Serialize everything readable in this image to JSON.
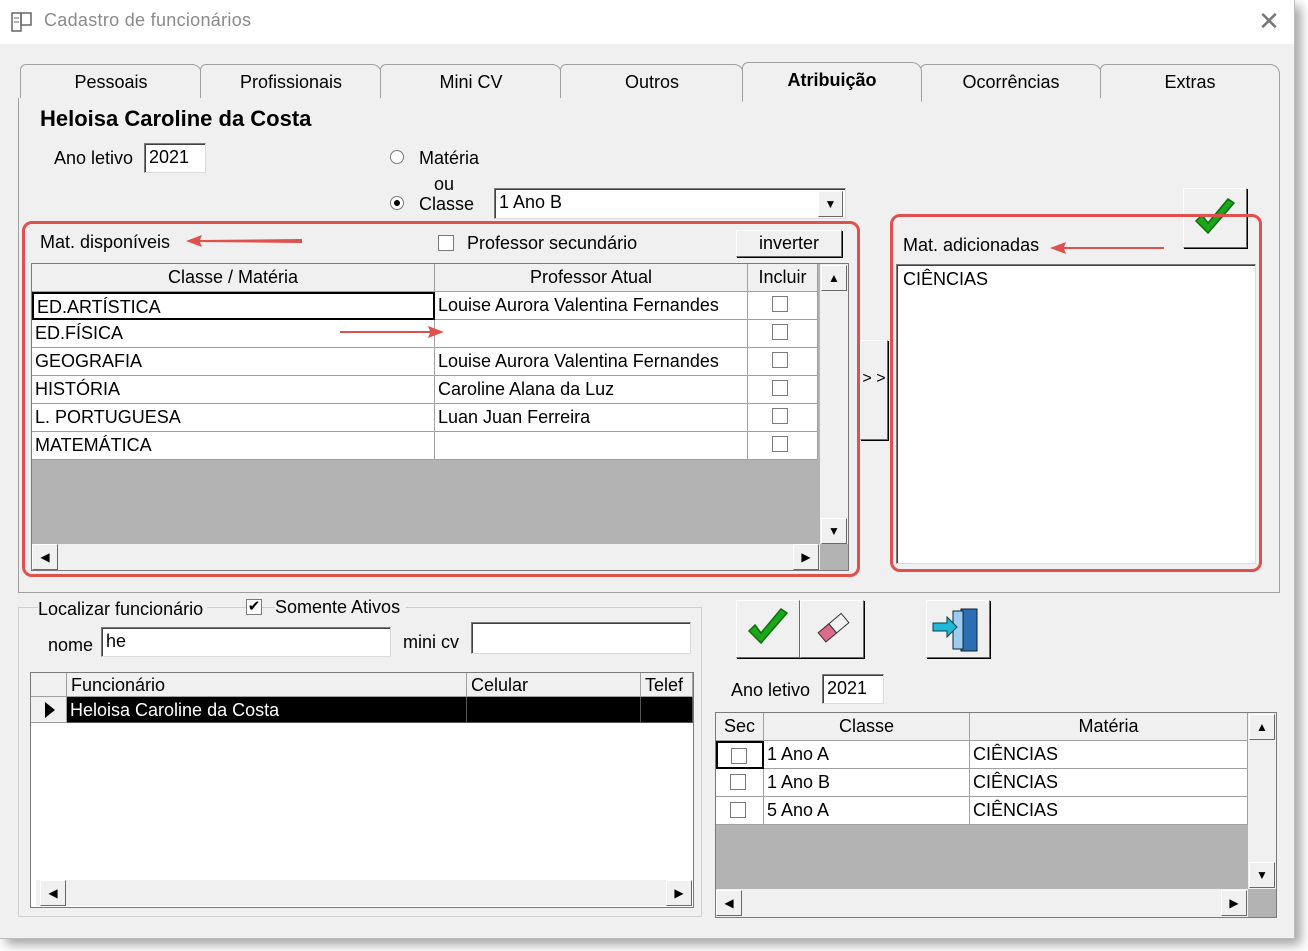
{
  "window": {
    "title": "Cadastro de funcionários",
    "close_label": "✕"
  },
  "tabs": [
    {
      "label": "Pessoais"
    },
    {
      "label": "Profissionais"
    },
    {
      "label": "Mini CV"
    },
    {
      "label": "Outros"
    },
    {
      "label": "Atribuição"
    },
    {
      "label": "Ocorrências"
    },
    {
      "label": "Extras"
    }
  ],
  "active_tab": "Atribuição",
  "employee_name": "Heloisa Caroline da Costa",
  "ano_letivo": {
    "label": "Ano letivo",
    "value": "2021"
  },
  "mode": {
    "materia_label": "Matéria",
    "ou_label": "ou",
    "classe_label": "Classe",
    "selected": "Classe",
    "classe_value": "1 Ano B"
  },
  "available": {
    "label": "Mat. disponíveis",
    "professor_secundario_label": "Professor secundário",
    "inverter_label": "inverter",
    "columns": [
      "Classe / Matéria",
      "Professor Atual",
      "Incluir"
    ],
    "rows": [
      {
        "materia": "ED.ARTÍSTICA",
        "professor": "Louise Aurora Valentina Fernandes"
      },
      {
        "materia": "ED.FÍSICA",
        "professor": ""
      },
      {
        "materia": "GEOGRAFIA",
        "professor": "Louise Aurora Valentina Fernandes"
      },
      {
        "materia": "HISTÓRIA",
        "professor": "Caroline Alana da Luz"
      },
      {
        "materia": "L. PORTUGUESA",
        "professor": "Luan Juan Ferreira"
      },
      {
        "materia": "MATEMÁTICA",
        "professor": ""
      }
    ]
  },
  "move_button_label": "> >",
  "added": {
    "label": "Mat. adicionadas",
    "items": [
      "CIÊNCIAS"
    ]
  },
  "search": {
    "group_label": "Localizar funcionário",
    "somente_ativos_label": "Somente Ativos",
    "somente_ativos_checked": true,
    "nome_label": "nome",
    "nome_value": "he",
    "minicv_label": "mini cv",
    "minicv_value": "",
    "columns": [
      "Funcionário",
      "Celular",
      "Telef"
    ],
    "rows": [
      {
        "funcionario": "Heloisa Caroline da Costa",
        "celular": "",
        "telefone": ""
      }
    ]
  },
  "assignments": {
    "ano_letivo_label": "Ano letivo",
    "ano_letivo_value": "2021",
    "columns": [
      "Sec",
      "Classe",
      "Matéria"
    ],
    "rows": [
      {
        "classe": "1 Ano A",
        "materia": "CIÊNCIAS"
      },
      {
        "classe": "1 Ano B",
        "materia": "CIÊNCIAS"
      },
      {
        "classe": "5 Ano A",
        "materia": "CIÊNCIAS"
      }
    ]
  },
  "colors": {
    "annotation_red": "#e0504c",
    "confirm_green": "#1aa81a",
    "selection_black": "#000000"
  }
}
